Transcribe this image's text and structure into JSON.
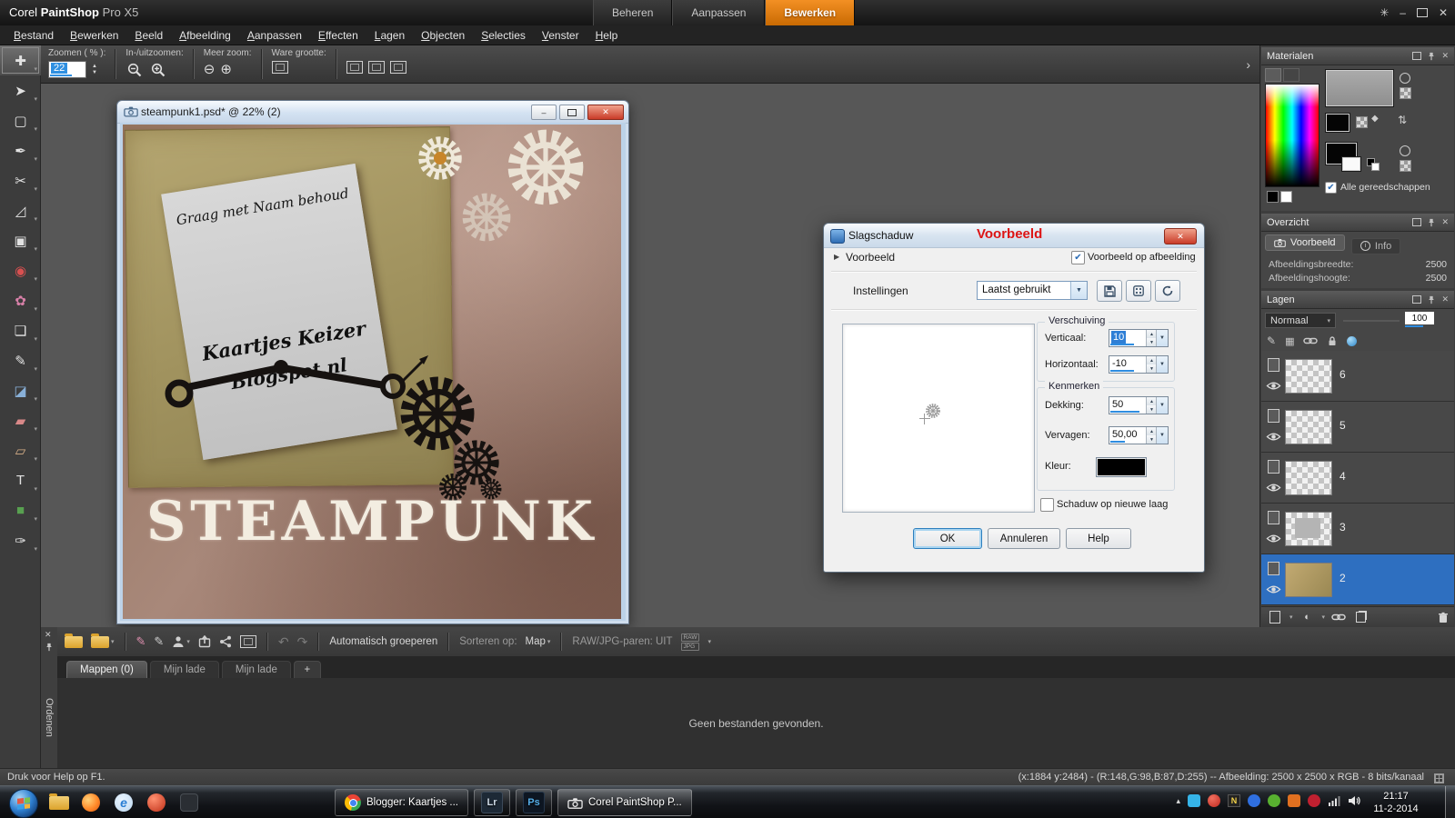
{
  "icons": {
    "close": "✕",
    "minimize": "–",
    "settings_star": "✳",
    "chevron_right": "›",
    "dropdown": "▼",
    "caret": "▾",
    "section_arrow": "▶",
    "check": "✔",
    "zoom_out": "⊖",
    "zoom_in": "⊕",
    "swap": "⇅",
    "plus": "+",
    "tray_expand": "▴",
    "rotate_left": "↶",
    "rotate_right": "↷",
    "ie_e": "e",
    "norton_n": "N",
    "raw": "RAW",
    "jpg": "JPG",
    "info_i": "i",
    "spin_up": "▲",
    "spin_down": "▼",
    "half_circle": "◐",
    "grid": "▦",
    "diamond": "◆",
    "brush": "✎"
  },
  "app": {
    "brand": "Corel",
    "product": "PaintShop",
    "edition": "Pro X5",
    "workspace_tabs": [
      {
        "label": "Beheren"
      },
      {
        "label": "Aanpassen"
      },
      {
        "label": "Bewerken"
      }
    ]
  },
  "menu": [
    "Bestand",
    "Bewerken",
    "Beeld",
    "Afbeelding",
    "Aanpassen",
    "Effecten",
    "Lagen",
    "Objecten",
    "Selecties",
    "Venster",
    "Help"
  ],
  "toolbar": {
    "zoom_label": "Zoomen ( % ):",
    "zoom_value": "22",
    "inout_label": "In-/uitzoomen:",
    "more_label": "Meer zoom:",
    "actual_label": "Ware grootte:"
  },
  "tools": [
    {
      "glyph": "✚"
    },
    {
      "glyph": "➤"
    },
    {
      "glyph": "▢"
    },
    {
      "glyph": "✒"
    },
    {
      "glyph": "✂"
    },
    {
      "glyph": "◿"
    },
    {
      "glyph": "▣"
    },
    {
      "glyph": "◉"
    },
    {
      "glyph": "✿"
    },
    {
      "glyph": "❏"
    },
    {
      "glyph": "✎"
    },
    {
      "glyph": "◪"
    },
    {
      "glyph": "▰"
    },
    {
      "glyph": "▱"
    },
    {
      "glyph": "T"
    },
    {
      "glyph": "■"
    },
    {
      "glyph": "✑"
    }
  ],
  "document_window": {
    "title": "steampunk1.psd* @  22% (2)",
    "canvas": {
      "card_line1": "Graag met Naam behoud",
      "card_name": "Kaartjes Keizer",
      "card_site": "Blogspot.nl",
      "title_text": "STEAMPUNK"
    }
  },
  "dialog": {
    "title": "Slagschaduw",
    "proof_label": "Voorbeeld",
    "section_voorbeeld": "Voorbeeld",
    "preview_on_image": "Voorbeeld op afbeelding",
    "settings_label": "Instellingen",
    "settings_value": "Laatst gebruikt",
    "verschuiving": "Verschuiving",
    "verticaal": "Verticaal:",
    "verticaal_value": "10",
    "horizontaal": "Horizontaal:",
    "horizontaal_value": "-10",
    "kenmerken": "Kenmerken",
    "dekking": "Dekking:",
    "dekking_value": "50",
    "vervagen": "Vervagen:",
    "vervagen_value": "50,00",
    "kleur": "Kleur:",
    "shadow_color": "#000000",
    "new_layer_label": "Schaduw op nieuwe laag",
    "ok": "OK",
    "cancel": "Annuleren",
    "help": "Help"
  },
  "panels": {
    "materials": {
      "title": "Materialen",
      "all_tools": "Alle gereedschappen"
    },
    "overview": {
      "title": "Overzicht",
      "tab_preview": "Voorbeeld",
      "tab_info": "Info",
      "rows": [
        {
          "label": "Afbeeldingsbreedte:",
          "value": "2500"
        },
        {
          "label": "Afbeeldingshoogte:",
          "value": "2500"
        }
      ]
    },
    "layers": {
      "title": "Lagen",
      "blend_mode": "Normaal",
      "opacity": "100",
      "items": [
        {
          "name": "6"
        },
        {
          "name": "5"
        },
        {
          "name": "4"
        },
        {
          "name": "3"
        },
        {
          "name": "2"
        }
      ]
    }
  },
  "organizer": {
    "vertical_label": "Ordenen",
    "auto_group": "Automatisch groeperen",
    "sort_label": "Sorteren op:",
    "sort_value": "Map",
    "rawjpg_label": "RAW/JPG-paren: UIT",
    "tabs": [
      {
        "label": "Mappen (0)"
      },
      {
        "label": "Mijn lade"
      },
      {
        "label": "Mijn lade"
      }
    ],
    "empty_text": "Geen bestanden gevonden."
  },
  "statusbar": {
    "left": "Druk voor Help op F1.",
    "right": "(x:1884 y:2484) - (R:148,G:98,B:87,D:255) -- Afbeelding: 2500 x 2500 x RGB - 8 bits/kanaal"
  },
  "taskbar": {
    "buttons": [
      {
        "label": "Blogger: Kaartjes ..."
      },
      {
        "label": "Lr"
      },
      {
        "label": "Ps"
      },
      {
        "label": "Corel PaintShop P..."
      }
    ],
    "time": "21:17",
    "date": "11-2-2014"
  }
}
